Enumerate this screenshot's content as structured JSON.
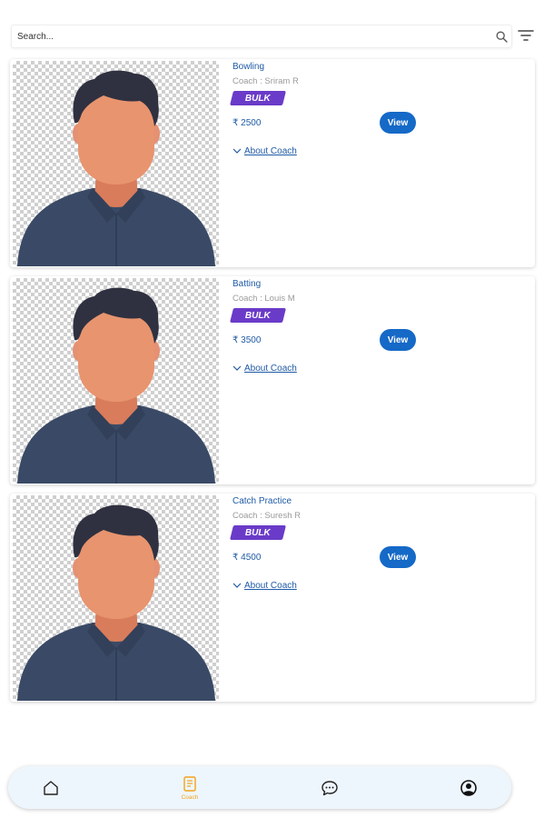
{
  "search": {
    "placeholder": "Search..."
  },
  "icons": {
    "search": "search-icon",
    "filter": "filter-icon",
    "expand": "chevron-down-icon",
    "nav_home": "home-icon",
    "nav_coach": "clipboard-icon",
    "nav_chat": "chat-bubble-icon",
    "nav_profile": "profile-icon"
  },
  "coaches": [
    {
      "title": "Bowling",
      "coach": "Coach : Sriram R",
      "badge": "BULK",
      "price": "₹ 2500",
      "view_label": "View",
      "about_label": "About Coach"
    },
    {
      "title": "Batting",
      "coach": "Coach : Louis M",
      "badge": "BULK",
      "price": "₹ 3500",
      "view_label": "View",
      "about_label": "About Coach"
    },
    {
      "title": "Catch Practice",
      "coach": "Coach : Suresh R",
      "badge": "BULK",
      "price": "₹ 4500",
      "view_label": "View",
      "about_label": "About Coach"
    }
  ],
  "bottom_nav": {
    "coach_label": "Coach",
    "active": "coach"
  },
  "colors": {
    "accent": "#1569c7",
    "badge": "#6a3bc8",
    "link": "#1f5aa6",
    "nav_active": "#f3a21b",
    "nav_bg": "#eef6fd"
  }
}
